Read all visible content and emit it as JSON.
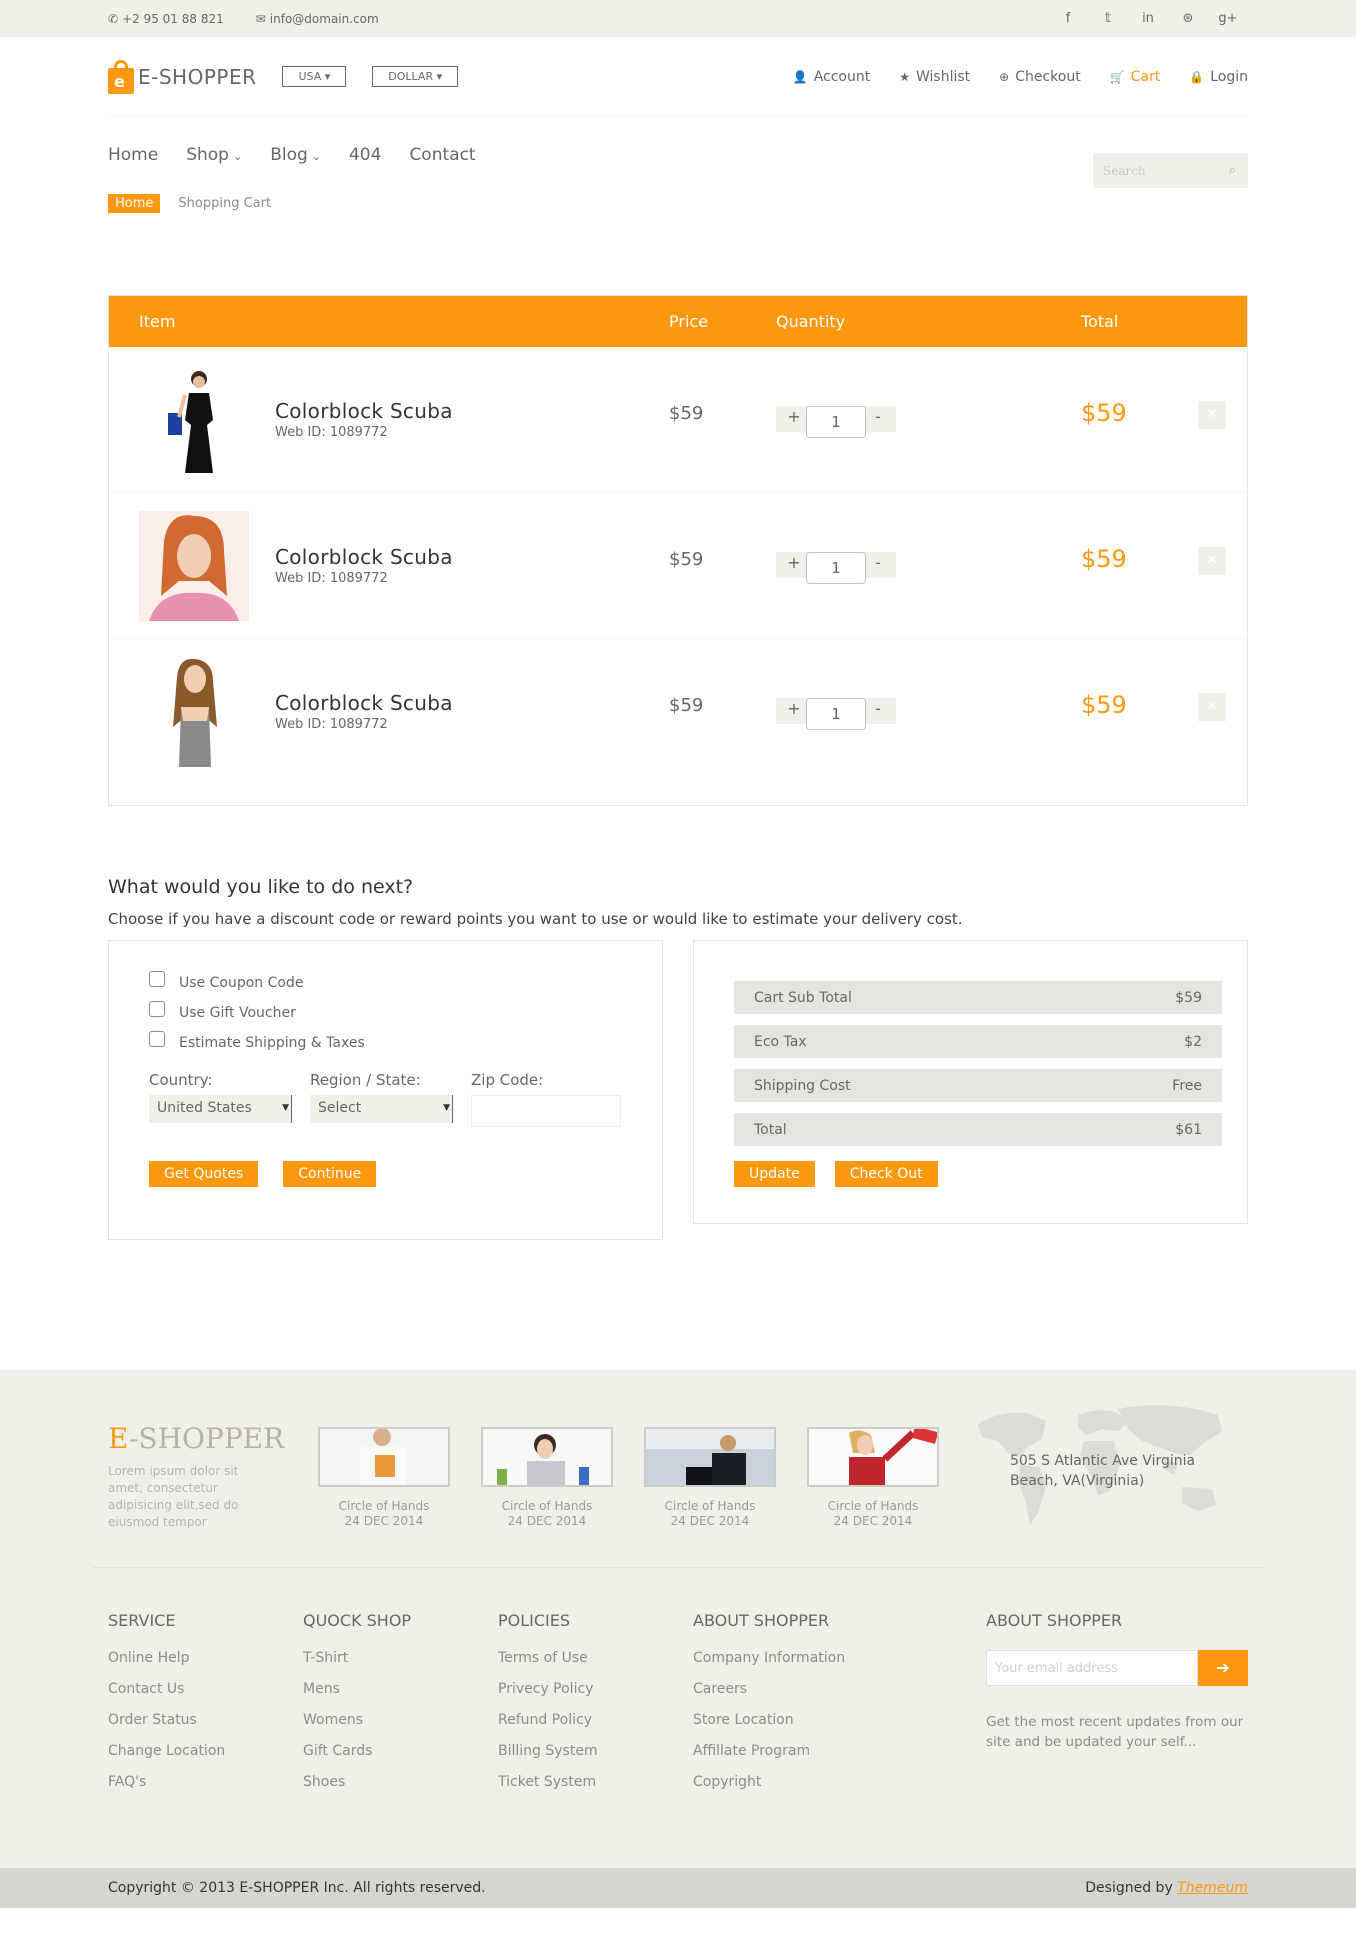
{
  "topbar": {
    "phone": "+2 95 01 88 821",
    "email": "info@domain.com",
    "social_icons": [
      "facebook-icon",
      "twitter-icon",
      "linkedin-icon",
      "dribbble-icon",
      "google-plus-icon"
    ]
  },
  "header": {
    "logo_text": "E-SHOPPER",
    "country": "USA",
    "currency": "DOLLAR",
    "menu": [
      "Account",
      "Wishlist",
      "Checkout",
      "Cart",
      "Login"
    ],
    "active_menu": "Cart"
  },
  "nav": {
    "items": [
      "Home",
      "Shop",
      "Blog",
      "404",
      "Contact"
    ],
    "search_placeholder": "Search"
  },
  "breadcrumb": {
    "home": "Home",
    "current": "Shopping Cart"
  },
  "cart": {
    "headers": {
      "item": "Item",
      "price": "Price",
      "quantity": "Quantity",
      "total": "Total"
    },
    "rows": [
      {
        "name": "Colorblock Scuba",
        "web_id": "Web ID: 1089772",
        "price": "$59",
        "qty": "1",
        "total": "$59"
      },
      {
        "name": "Colorblock Scuba",
        "web_id": "Web ID: 1089772",
        "price": "$59",
        "qty": "1",
        "total": "$59"
      },
      {
        "name": "Colorblock Scuba",
        "web_id": "Web ID: 1089772",
        "price": "$59",
        "qty": "1",
        "total": "$59"
      }
    ],
    "plus": "+",
    "minus": "-"
  },
  "do_next": {
    "title": "What would you like to do next?",
    "subtitle": "Choose if you have a discount code or reward points you want to use or would like to estimate your delivery cost.",
    "options": [
      "Use Coupon Code",
      "Use Gift Voucher",
      "Estimate Shipping & Taxes"
    ],
    "country_label": "Country:",
    "country_value": "United States",
    "region_label": "Region / State:",
    "region_value": "Select",
    "zip_label": "Zip Code:",
    "get_quotes": "Get Quotes",
    "continue": "Continue"
  },
  "summary": {
    "rows": [
      {
        "label": "Cart Sub Total",
        "value": "$59"
      },
      {
        "label": "Eco Tax",
        "value": "$2"
      },
      {
        "label": "Shipping Cost",
        "value": "Free"
      },
      {
        "label": "Total",
        "value": "$61"
      }
    ],
    "update": "Update",
    "checkout": "Check Out"
  },
  "footer": {
    "brand_e": "E",
    "brand_rest": "-SHOPPER",
    "brand_desc": "Lorem ipsum dolor sit amet, consectetur adipisicing elit,sed do eiusmod tempor",
    "videos": [
      {
        "title": "Circle of Hands",
        "date": "24 DEC 2014"
      },
      {
        "title": "Circle of Hands",
        "date": "24 DEC 2014"
      },
      {
        "title": "Circle of Hands",
        "date": "24 DEC 2014"
      },
      {
        "title": "Circle of Hands",
        "date": "24 DEC 2014"
      }
    ],
    "address": "505 S Atlantic Ave Virginia Beach, VA(Virginia)",
    "columns": [
      {
        "title": "SERVICE",
        "links": [
          "Online Help",
          "Contact Us",
          "Order Status",
          "Change Location",
          "FAQ's"
        ]
      },
      {
        "title": "QUOCK SHOP",
        "links": [
          "T-Shirt",
          "Mens",
          "Womens",
          "Gift Cards",
          "Shoes"
        ]
      },
      {
        "title": "POLICIES",
        "links": [
          "Terms of Use",
          "Privecy Policy",
          "Refund Policy",
          "Billing System",
          "Ticket System"
        ]
      },
      {
        "title": "ABOUT SHOPPER",
        "links": [
          "Company Information",
          "Careers",
          "Store Location",
          "Affillate Program",
          "Copyright"
        ]
      }
    ],
    "subscribe_title": "ABOUT SHOPPER",
    "subscribe_placeholder": "Your email address",
    "subscribe_text": "Get the most recent updates from our site and be updated your self...",
    "copyright": "Copyright © 2013 E-SHOPPER Inc. All rights reserved.",
    "designed_by": "Designed by",
    "designer": "Themeum"
  },
  "colors": {
    "accent": "#fe980f",
    "bar_bg": "#f0f0e9",
    "row_bg": "#e6e4df"
  }
}
